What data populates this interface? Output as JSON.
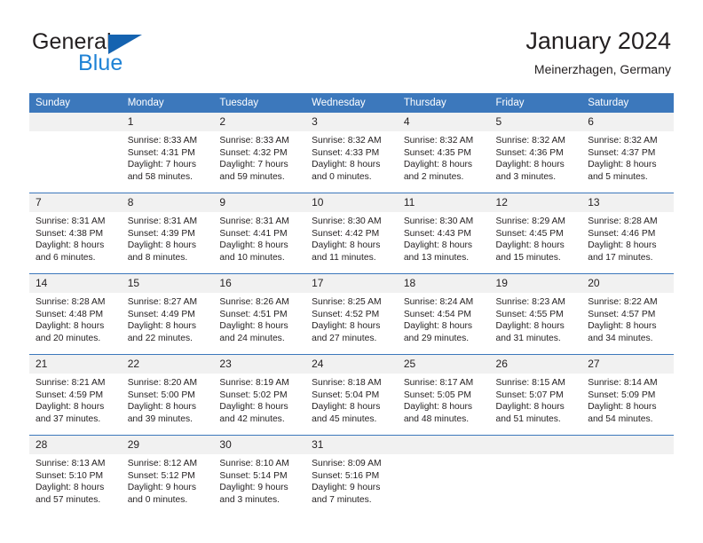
{
  "brand": {
    "name_dark": "General",
    "name_light": "Blue",
    "accent_color": "#1f82d5",
    "triangle_color": "#1563b0"
  },
  "header": {
    "title": "January 2024",
    "subtitle": "Meinerzhagen, Germany",
    "header_bg_color": "#3c78bc",
    "daynum_bg_color": "#f1f1f1"
  },
  "weekday_headers": [
    "Sunday",
    "Monday",
    "Tuesday",
    "Wednesday",
    "Thursday",
    "Friday",
    "Saturday"
  ],
  "weeks": [
    [
      {
        "day": "",
        "sunrise": "",
        "sunset": "",
        "daylight_line1": "",
        "daylight_line2": ""
      },
      {
        "day": "1",
        "sunrise": "Sunrise: 8:33 AM",
        "sunset": "Sunset: 4:31 PM",
        "daylight_line1": "Daylight: 7 hours",
        "daylight_line2": "and 58 minutes."
      },
      {
        "day": "2",
        "sunrise": "Sunrise: 8:33 AM",
        "sunset": "Sunset: 4:32 PM",
        "daylight_line1": "Daylight: 7 hours",
        "daylight_line2": "and 59 minutes."
      },
      {
        "day": "3",
        "sunrise": "Sunrise: 8:32 AM",
        "sunset": "Sunset: 4:33 PM",
        "daylight_line1": "Daylight: 8 hours",
        "daylight_line2": "and 0 minutes."
      },
      {
        "day": "4",
        "sunrise": "Sunrise: 8:32 AM",
        "sunset": "Sunset: 4:35 PM",
        "daylight_line1": "Daylight: 8 hours",
        "daylight_line2": "and 2 minutes."
      },
      {
        "day": "5",
        "sunrise": "Sunrise: 8:32 AM",
        "sunset": "Sunset: 4:36 PM",
        "daylight_line1": "Daylight: 8 hours",
        "daylight_line2": "and 3 minutes."
      },
      {
        "day": "6",
        "sunrise": "Sunrise: 8:32 AM",
        "sunset": "Sunset: 4:37 PM",
        "daylight_line1": "Daylight: 8 hours",
        "daylight_line2": "and 5 minutes."
      }
    ],
    [
      {
        "day": "7",
        "sunrise": "Sunrise: 8:31 AM",
        "sunset": "Sunset: 4:38 PM",
        "daylight_line1": "Daylight: 8 hours",
        "daylight_line2": "and 6 minutes."
      },
      {
        "day": "8",
        "sunrise": "Sunrise: 8:31 AM",
        "sunset": "Sunset: 4:39 PM",
        "daylight_line1": "Daylight: 8 hours",
        "daylight_line2": "and 8 minutes."
      },
      {
        "day": "9",
        "sunrise": "Sunrise: 8:31 AM",
        "sunset": "Sunset: 4:41 PM",
        "daylight_line1": "Daylight: 8 hours",
        "daylight_line2": "and 10 minutes."
      },
      {
        "day": "10",
        "sunrise": "Sunrise: 8:30 AM",
        "sunset": "Sunset: 4:42 PM",
        "daylight_line1": "Daylight: 8 hours",
        "daylight_line2": "and 11 minutes."
      },
      {
        "day": "11",
        "sunrise": "Sunrise: 8:30 AM",
        "sunset": "Sunset: 4:43 PM",
        "daylight_line1": "Daylight: 8 hours",
        "daylight_line2": "and 13 minutes."
      },
      {
        "day": "12",
        "sunrise": "Sunrise: 8:29 AM",
        "sunset": "Sunset: 4:45 PM",
        "daylight_line1": "Daylight: 8 hours",
        "daylight_line2": "and 15 minutes."
      },
      {
        "day": "13",
        "sunrise": "Sunrise: 8:28 AM",
        "sunset": "Sunset: 4:46 PM",
        "daylight_line1": "Daylight: 8 hours",
        "daylight_line2": "and 17 minutes."
      }
    ],
    [
      {
        "day": "14",
        "sunrise": "Sunrise: 8:28 AM",
        "sunset": "Sunset: 4:48 PM",
        "daylight_line1": "Daylight: 8 hours",
        "daylight_line2": "and 20 minutes."
      },
      {
        "day": "15",
        "sunrise": "Sunrise: 8:27 AM",
        "sunset": "Sunset: 4:49 PM",
        "daylight_line1": "Daylight: 8 hours",
        "daylight_line2": "and 22 minutes."
      },
      {
        "day": "16",
        "sunrise": "Sunrise: 8:26 AM",
        "sunset": "Sunset: 4:51 PM",
        "daylight_line1": "Daylight: 8 hours",
        "daylight_line2": "and 24 minutes."
      },
      {
        "day": "17",
        "sunrise": "Sunrise: 8:25 AM",
        "sunset": "Sunset: 4:52 PM",
        "daylight_line1": "Daylight: 8 hours",
        "daylight_line2": "and 27 minutes."
      },
      {
        "day": "18",
        "sunrise": "Sunrise: 8:24 AM",
        "sunset": "Sunset: 4:54 PM",
        "daylight_line1": "Daylight: 8 hours",
        "daylight_line2": "and 29 minutes."
      },
      {
        "day": "19",
        "sunrise": "Sunrise: 8:23 AM",
        "sunset": "Sunset: 4:55 PM",
        "daylight_line1": "Daylight: 8 hours",
        "daylight_line2": "and 31 minutes."
      },
      {
        "day": "20",
        "sunrise": "Sunrise: 8:22 AM",
        "sunset": "Sunset: 4:57 PM",
        "daylight_line1": "Daylight: 8 hours",
        "daylight_line2": "and 34 minutes."
      }
    ],
    [
      {
        "day": "21",
        "sunrise": "Sunrise: 8:21 AM",
        "sunset": "Sunset: 4:59 PM",
        "daylight_line1": "Daylight: 8 hours",
        "daylight_line2": "and 37 minutes."
      },
      {
        "day": "22",
        "sunrise": "Sunrise: 8:20 AM",
        "sunset": "Sunset: 5:00 PM",
        "daylight_line1": "Daylight: 8 hours",
        "daylight_line2": "and 39 minutes."
      },
      {
        "day": "23",
        "sunrise": "Sunrise: 8:19 AM",
        "sunset": "Sunset: 5:02 PM",
        "daylight_line1": "Daylight: 8 hours",
        "daylight_line2": "and 42 minutes."
      },
      {
        "day": "24",
        "sunrise": "Sunrise: 8:18 AM",
        "sunset": "Sunset: 5:04 PM",
        "daylight_line1": "Daylight: 8 hours",
        "daylight_line2": "and 45 minutes."
      },
      {
        "day": "25",
        "sunrise": "Sunrise: 8:17 AM",
        "sunset": "Sunset: 5:05 PM",
        "daylight_line1": "Daylight: 8 hours",
        "daylight_line2": "and 48 minutes."
      },
      {
        "day": "26",
        "sunrise": "Sunrise: 8:15 AM",
        "sunset": "Sunset: 5:07 PM",
        "daylight_line1": "Daylight: 8 hours",
        "daylight_line2": "and 51 minutes."
      },
      {
        "day": "27",
        "sunrise": "Sunrise: 8:14 AM",
        "sunset": "Sunset: 5:09 PM",
        "daylight_line1": "Daylight: 8 hours",
        "daylight_line2": "and 54 minutes."
      }
    ],
    [
      {
        "day": "28",
        "sunrise": "Sunrise: 8:13 AM",
        "sunset": "Sunset: 5:10 PM",
        "daylight_line1": "Daylight: 8 hours",
        "daylight_line2": "and 57 minutes."
      },
      {
        "day": "29",
        "sunrise": "Sunrise: 8:12 AM",
        "sunset": "Sunset: 5:12 PM",
        "daylight_line1": "Daylight: 9 hours",
        "daylight_line2": "and 0 minutes."
      },
      {
        "day": "30",
        "sunrise": "Sunrise: 8:10 AM",
        "sunset": "Sunset: 5:14 PM",
        "daylight_line1": "Daylight: 9 hours",
        "daylight_line2": "and 3 minutes."
      },
      {
        "day": "31",
        "sunrise": "Sunrise: 8:09 AM",
        "sunset": "Sunset: 5:16 PM",
        "daylight_line1": "Daylight: 9 hours",
        "daylight_line2": "and 7 minutes."
      },
      {
        "day": "",
        "sunrise": "",
        "sunset": "",
        "daylight_line1": "",
        "daylight_line2": ""
      },
      {
        "day": "",
        "sunrise": "",
        "sunset": "",
        "daylight_line1": "",
        "daylight_line2": ""
      },
      {
        "day": "",
        "sunrise": "",
        "sunset": "",
        "daylight_line1": "",
        "daylight_line2": ""
      }
    ]
  ]
}
